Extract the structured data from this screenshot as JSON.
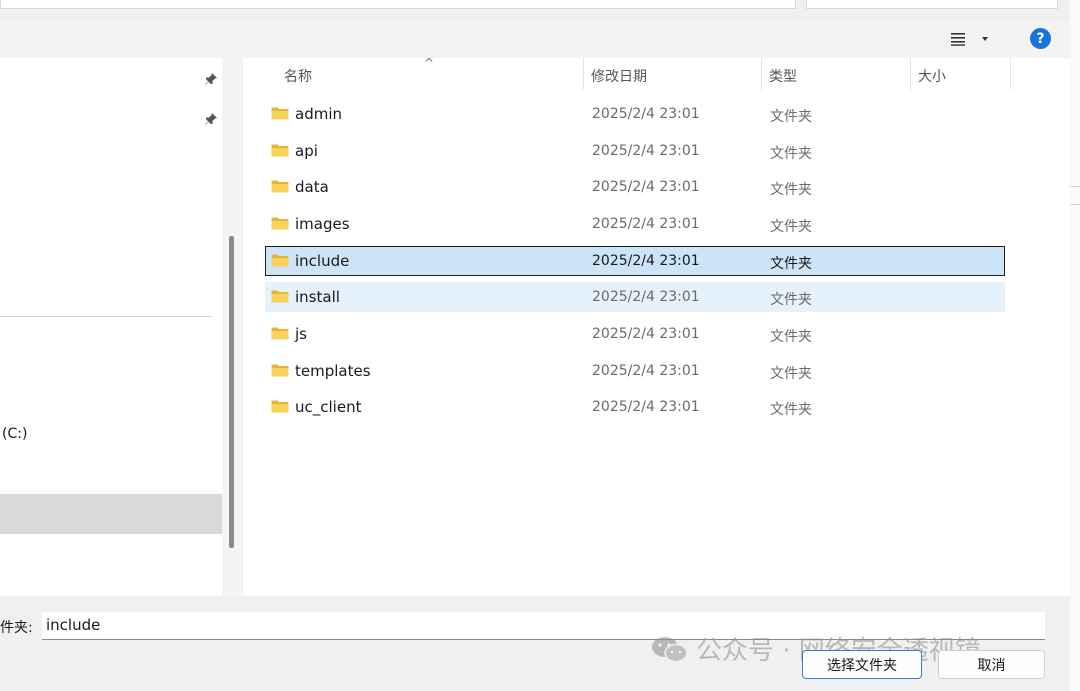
{
  "toolbar": {
    "view_icon": "list-view-icon",
    "help_label": "?"
  },
  "nav": {
    "drive_label": "(C:)"
  },
  "columns": {
    "name": "名称",
    "modified": "修改日期",
    "type": "类型",
    "size": "大小"
  },
  "files": [
    {
      "name": "admin",
      "date": "2025/2/4 23:01",
      "type": "文件夹"
    },
    {
      "name": "api",
      "date": "2025/2/4 23:01",
      "type": "文件夹"
    },
    {
      "name": "data",
      "date": "2025/2/4 23:01",
      "type": "文件夹"
    },
    {
      "name": "images",
      "date": "2025/2/4 23:01",
      "type": "文件夹"
    },
    {
      "name": "include",
      "date": "2025/2/4 23:01",
      "type": "文件夹"
    },
    {
      "name": "install",
      "date": "2025/2/4 23:01",
      "type": "文件夹"
    },
    {
      "name": "js",
      "date": "2025/2/4 23:01",
      "type": "文件夹"
    },
    {
      "name": "templates",
      "date": "2025/2/4 23:01",
      "type": "文件夹"
    },
    {
      "name": "uc_client",
      "date": "2025/2/4 23:01",
      "type": "文件夹"
    }
  ],
  "bottom": {
    "folder_label": "件夹:",
    "folder_value": "include",
    "select_button": "选择文件夹",
    "cancel_button": "取消"
  },
  "watermark": {
    "text": "公众号 · 网络安全透视镜"
  },
  "colors": {
    "selected_row": "#cce4f7",
    "hover_row": "#e5f1fb",
    "folder_yellow": "#f4c542",
    "accent": "#1a73d8"
  }
}
